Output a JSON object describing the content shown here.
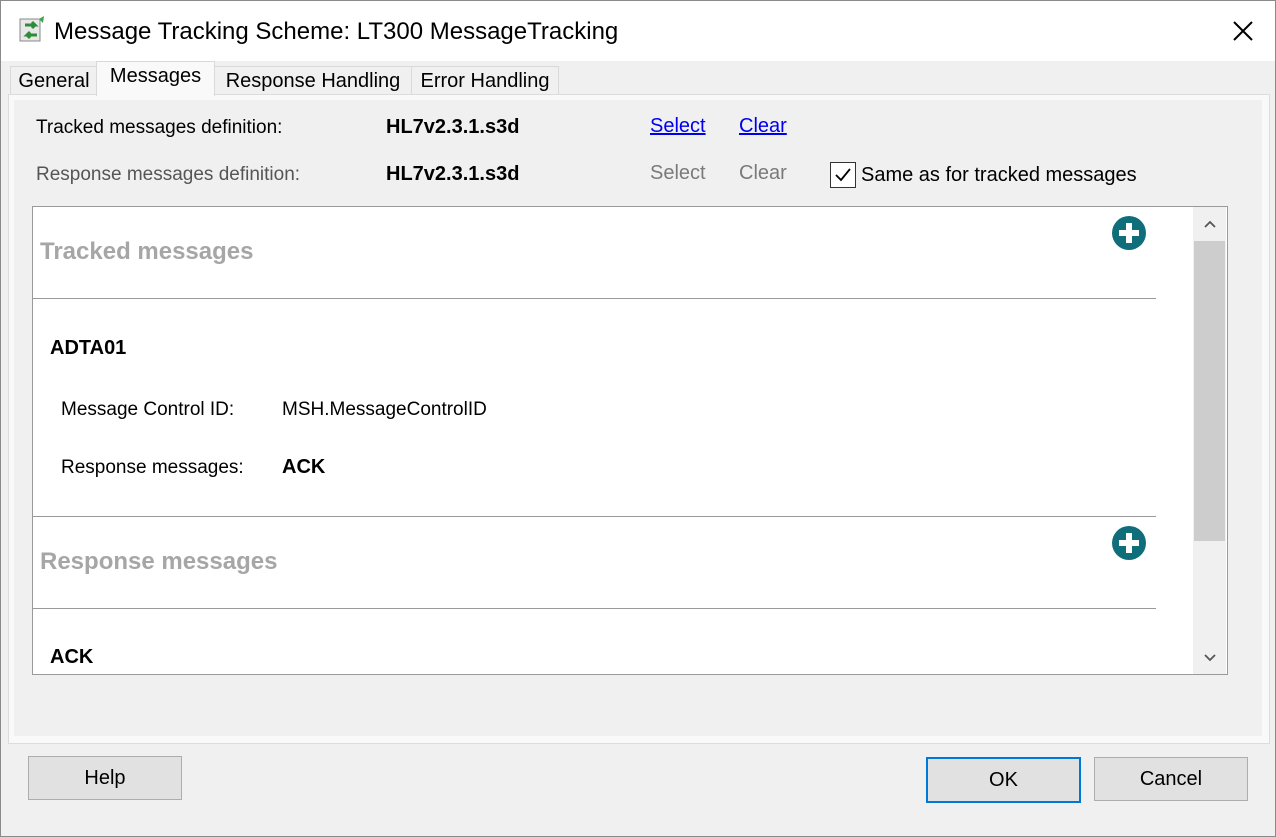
{
  "window": {
    "title": "Message Tracking Scheme: LT300 MessageTracking",
    "app_icon": "message-tracking-app-icon",
    "close_icon": "close-icon"
  },
  "tabs": [
    {
      "label": "General",
      "active": false
    },
    {
      "label": "Messages",
      "active": true
    },
    {
      "label": "Response Handling",
      "active": false
    },
    {
      "label": "Error Handling",
      "active": false
    }
  ],
  "definitions": {
    "tracked": {
      "label": "Tracked messages definition:",
      "value": "HL7v2.3.1.s3d",
      "select": "Select",
      "clear": "Clear"
    },
    "response": {
      "label": "Response messages definition:",
      "value": "HL7v2.3.1.s3d",
      "select": "Select",
      "clear": "Clear",
      "same_checkbox_label": "Same as for tracked messages",
      "same_checked": true
    }
  },
  "tracked_section": {
    "title": "Tracked messages",
    "add_icon": "plus-circle-icon",
    "items": [
      {
        "name": "ADTA01",
        "control_id_label": "Message Control ID:",
        "control_id_value": "MSH.MessageControlID",
        "response_label": "Response messages:",
        "response_value": "ACK"
      }
    ]
  },
  "response_section": {
    "title": "Response messages",
    "add_icon": "plus-circle-icon",
    "items": [
      {
        "name": "ACK"
      }
    ]
  },
  "buttons": {
    "help": "Help",
    "ok": "OK",
    "cancel": "Cancel"
  },
  "colors": {
    "accent": "#0078d7",
    "add_icon": "#0f6e7a",
    "link": "#0000ee",
    "section_title": "#a6a6a6"
  }
}
